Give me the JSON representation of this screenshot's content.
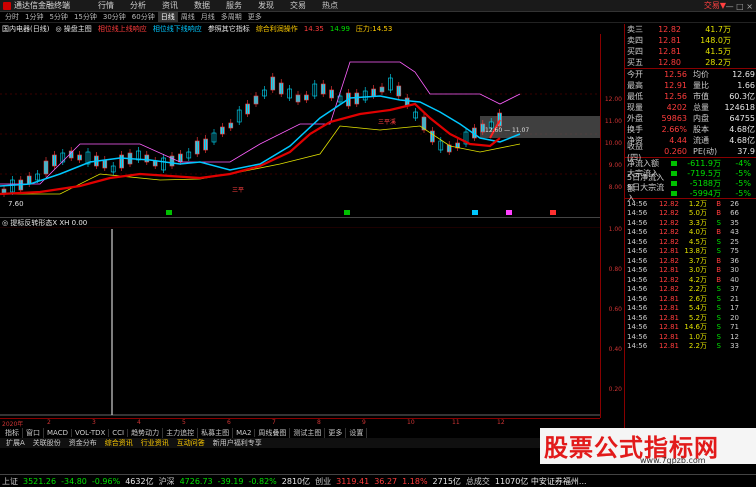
{
  "window": {
    "app_title": "通达信金融终端",
    "menu": [
      "行情",
      "分析",
      "资讯",
      "数据",
      "服务",
      "发现",
      "交易",
      "热点"
    ],
    "right_text": "交易▼",
    "win_controls": "— □ ×"
  },
  "periods": [
    "分时",
    "1分钟",
    "5分钟",
    "15分钟",
    "30分钟",
    "60分钟",
    "日线",
    "周线",
    "月线",
    "多周期",
    "更多"
  ],
  "indicator_bar": [
    {
      "text": "国内电器(日线)",
      "color": "#e8e8e8"
    },
    {
      "text": "◎ 操盘主图",
      "color": "#e8e8e8"
    },
    {
      "text": "相位线上线响应",
      "color": "#ff3c3c"
    },
    {
      "text": "相位线下线响应",
      "color": "#00c8ff"
    },
    {
      "text": "参照其它指标",
      "color": "#e8e8e8"
    },
    {
      "text": "综合利润操作",
      "color": "#ffcc00"
    },
    {
      "text": "14.35",
      "color": "#ff3c3c"
    },
    {
      "text": "14.99",
      "color": "#00e000"
    },
    {
      "text": "压力:14.53",
      "color": "#ffcc00"
    }
  ],
  "main_labels": {
    "low_price": "7.60",
    "marker_ranges": "12.60 — 11.07",
    "buy": "三平",
    "mid_label": "三平溪"
  },
  "sub_header": {
    "title": "◎ 提标反转形态X XH 0.00"
  },
  "date_axis": [
    "2020年",
    "2",
    "3",
    "4",
    "5",
    "6",
    "7",
    "8",
    "9",
    "10",
    "11",
    "12"
  ],
  "price_axis": [
    "12.00",
    "11.00",
    "10.00",
    "9.00",
    "8.00"
  ],
  "sub_axis": [
    "1.00",
    "0.80",
    "0.60",
    "0.40",
    "0.20"
  ],
  "quote": {
    "asks": [
      {
        "k": "卖三",
        "p": "12.82",
        "v": "",
        "c": "41.7万"
      },
      {
        "k": "卖四",
        "p": "12.81",
        "v": "",
        "c": "148.0万"
      },
      {
        "k": "买四",
        "p": "12.81",
        "v": "",
        "c": "41.5万"
      },
      {
        "k": "买五",
        "p": "12.80",
        "v": "",
        "c": "28.2万"
      }
    ],
    "info": [
      {
        "k": "今开",
        "v": "12.56",
        "k2": "均价",
        "v2": "12.69"
      },
      {
        "k": "最高",
        "v": "12.91",
        "k2": "量比",
        "v2": "1.66"
      },
      {
        "k": "最低",
        "v": "12.56",
        "k2": "市值",
        "v2": "60.3亿"
      },
      {
        "k": "现量",
        "v": "4202",
        "k2": "总量",
        "v2": "124618"
      },
      {
        "k": "外盘",
        "v": "59863",
        "k2": "内盘",
        "v2": "64755"
      },
      {
        "k": "换手",
        "v": "2.66%",
        "k2": "股本",
        "v2": "4.68亿"
      },
      {
        "k": "净资",
        "v": "4.44",
        "k2": "流通",
        "v2": "4.68亿"
      },
      {
        "k": "收益(四)",
        "v": "0.260",
        "k2": "PE(动)",
        "v2": "37.9"
      }
    ],
    "flow": [
      {
        "k": "净流入额",
        "v": "-611.9万",
        "p": "-4%"
      },
      {
        "k": "大宗流入",
        "v": "-719.5万",
        "p": "-5%"
      },
      {
        "k": "5日净流入额",
        "v": "-5188万",
        "p": "-5%"
      },
      {
        "k": "5日大宗流入",
        "v": "-5994万",
        "p": "-5%"
      }
    ],
    "ticks": [
      {
        "t": "14:56",
        "p": "12.82",
        "v": "1.2万",
        "bs": "B",
        "n": "26"
      },
      {
        "t": "14:56",
        "p": "12.82",
        "v": "5.0万",
        "bs": "B",
        "n": "66"
      },
      {
        "t": "14:56",
        "p": "12.82",
        "v": "3.3万",
        "bs": "S",
        "n": "35"
      },
      {
        "t": "14:56",
        "p": "12.82",
        "v": "4.0万",
        "bs": "B",
        "n": "43"
      },
      {
        "t": "14:56",
        "p": "12.82",
        "v": "4.5万",
        "bs": "S",
        "n": "25"
      },
      {
        "t": "14:56",
        "p": "12.81",
        "v": "13.8万",
        "bs": "S",
        "n": "75"
      },
      {
        "t": "14:56",
        "p": "12.82",
        "v": "3.7万",
        "bs": "B",
        "n": "36"
      },
      {
        "t": "14:56",
        "p": "12.81",
        "v": "3.0万",
        "bs": "B",
        "n": "30"
      },
      {
        "t": "14:56",
        "p": "12.82",
        "v": "4.2万",
        "bs": "B",
        "n": "40"
      },
      {
        "t": "14:56",
        "p": "12.82",
        "v": "2.2万",
        "bs": "S",
        "n": "37"
      },
      {
        "t": "14:56",
        "p": "12.81",
        "v": "2.6万",
        "bs": "S",
        "n": "21"
      },
      {
        "t": "14:56",
        "p": "12.81",
        "v": "5.4万",
        "bs": "S",
        "n": "17"
      },
      {
        "t": "14:56",
        "p": "12.81",
        "v": "5.2万",
        "bs": "S",
        "n": "20"
      },
      {
        "t": "14:56",
        "p": "12.81",
        "v": "14.6万",
        "bs": "S",
        "n": "71"
      },
      {
        "t": "14:56",
        "p": "12.81",
        "v": "1.0万",
        "bs": "S",
        "n": "12"
      },
      {
        "t": "14:56",
        "p": "12.81",
        "v": "2.2万",
        "bs": "S",
        "n": "33"
      }
    ]
  },
  "tabs_row1": [
    "指标",
    "窗口",
    "MACD",
    "VOL-TDX",
    "CCI",
    "趋势动力",
    "主力追控",
    "私募主图",
    "MA2",
    "周线叠图",
    "测试主图",
    "更多",
    "设置"
  ],
  "tabs_row2": [
    {
      "text": "扩展A",
      "hl": false
    },
    {
      "text": "关联股份",
      "hl": false
    },
    {
      "text": "资金分布",
      "hl": false
    },
    {
      "text": "综合资讯",
      "hl": true
    },
    {
      "text": "行业资讯",
      "hl": true
    },
    {
      "text": "互动问答",
      "hl": true
    },
    {
      "text": "新用户福利专享",
      "hl": false
    }
  ],
  "watermark": {
    "big": "股票公式指标网",
    "url": "www.7gpzb.com"
  },
  "status": [
    {
      "text": "上证",
      "cls": "lbl"
    },
    {
      "text": "3521.26",
      "cls": "green"
    },
    {
      "text": "-34.80",
      "cls": "green"
    },
    {
      "text": "-0.96%",
      "cls": "green"
    },
    {
      "text": "4632亿",
      "cls": "white"
    },
    {
      "text": "沪深",
      "cls": "lbl"
    },
    {
      "text": "4726.73",
      "cls": "green"
    },
    {
      "text": "-39.19",
      "cls": "green"
    },
    {
      "text": "-0.82%",
      "cls": "green"
    },
    {
      "text": "2810亿",
      "cls": "white"
    },
    {
      "text": "创业",
      "cls": "lbl"
    },
    {
      "text": "3119.41",
      "cls": "red"
    },
    {
      "text": "36.27",
      "cls": "red"
    },
    {
      "text": "1.18%",
      "cls": "red"
    },
    {
      "text": "2715亿",
      "cls": "white"
    },
    {
      "text": "总成交",
      "cls": "lbl"
    },
    {
      "text": "11070亿 中安证券福州...",
      "cls": "white"
    }
  ],
  "colors": {
    "up": "#ff3c3c",
    "down": "#00e000",
    "ma": "#e00000",
    "ma2": "#00c8ff",
    "axis": "#800000"
  }
}
